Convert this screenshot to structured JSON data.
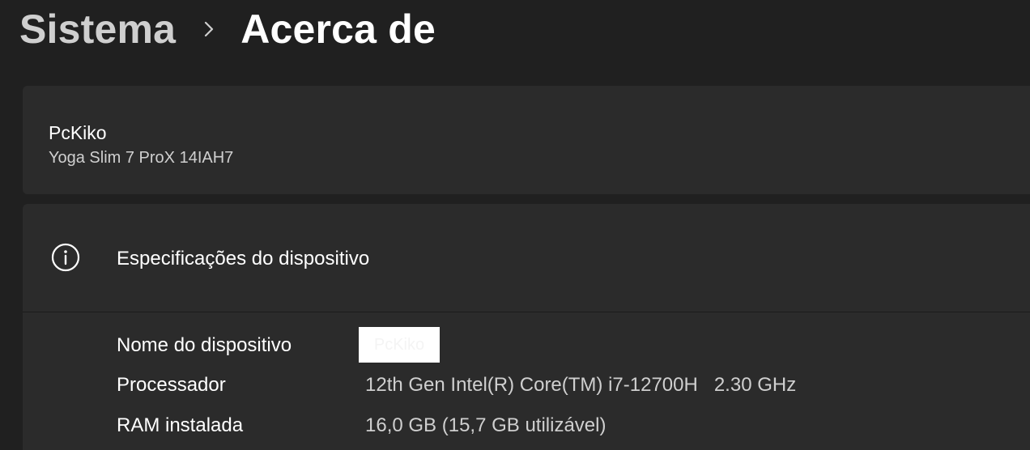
{
  "breadcrumb": {
    "parent": "Sistema",
    "separator_icon": "chevron-right-icon",
    "current": "Acerca de"
  },
  "device_card": {
    "name": "PcKiko",
    "model": "Yoga Slim 7 ProX 14IAH7"
  },
  "specs": {
    "icon": "info-icon",
    "title": "Especificações do dispositivo",
    "rows": [
      {
        "label": "Nome do dispositivo",
        "value": "PcKiko"
      },
      {
        "label": "Processador",
        "value": "12th Gen Intel(R) Core(TM) i7-12700H   2.30 GHz"
      },
      {
        "label": "RAM instalada",
        "value": "16,0 GB (15,7 GB utilizável)"
      }
    ]
  },
  "colors": {
    "background": "#202020",
    "card": "#2b2b2b",
    "text_primary": "#ffffff",
    "text_secondary": "#cfcfcf"
  }
}
